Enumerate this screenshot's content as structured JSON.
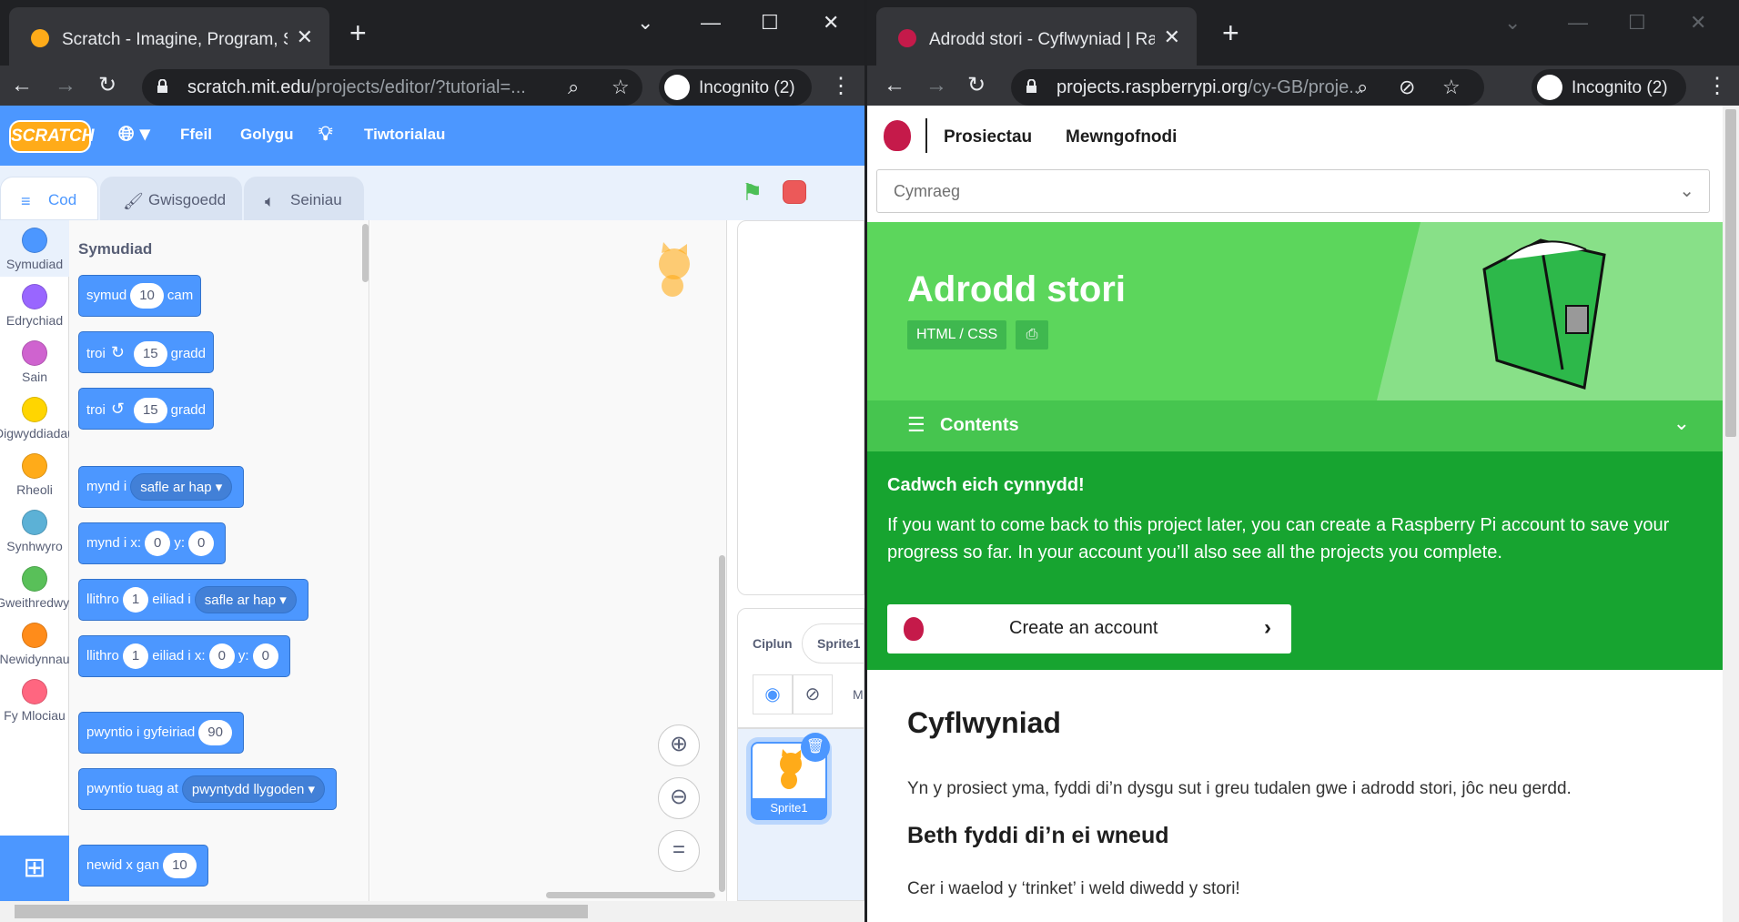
{
  "left_browser": {
    "tab_title": "Scratch - Imagine, Program, Share",
    "url_domain": "scratch.mit.edu",
    "url_path": "/projects/editor/?tutorial=...",
    "incognito": "Incognito (2)"
  },
  "right_browser": {
    "tab_title": "Adrodd stori - Cyflwyniad | Raspberry Pi Projects",
    "url_domain": "projects.raspberrypi.org",
    "url_path": "/cy-GB/proje...",
    "incognito": "Incognito (2)"
  },
  "scratch": {
    "logo": "SCRATCH",
    "menu": {
      "file": "Ffeil",
      "edit": "Golygu",
      "tutorials": "Tiwtorialau"
    },
    "tabs": {
      "code": "Cod",
      "costumes": "Gwisgoedd",
      "sounds": "Seiniau"
    },
    "categories": [
      {
        "label": "Symudiad",
        "color": "#4c97ff"
      },
      {
        "label": "Edrychiad",
        "color": "#9966ff"
      },
      {
        "label": "Sain",
        "color": "#cf63cf"
      },
      {
        "label": "Digwyddiadau",
        "color": "#ffd500"
      },
      {
        "label": "Rheoli",
        "color": "#ffab19"
      },
      {
        "label": "Synhwyro",
        "color": "#5cb1d6"
      },
      {
        "label": "Gweithredwyr",
        "color": "#59c059"
      },
      {
        "label": "Newidynnau",
        "color": "#ff8c1a"
      },
      {
        "label": "Fy Mlociau",
        "color": "#ff6680"
      }
    ],
    "palette_title": "Symudiad",
    "blocks": {
      "b1": {
        "a": "symud",
        "v": "10",
        "b": "cam"
      },
      "b2": {
        "a": "troi",
        "v": "15",
        "b": "gradd"
      },
      "b3": {
        "a": "troi",
        "v": "15",
        "b": "gradd"
      },
      "b4": {
        "a": "mynd i",
        "d": "safle ar hap"
      },
      "b5": {
        "a": "mynd i x:",
        "v1": "0",
        "b": "y:",
        "v2": "0"
      },
      "b6": {
        "a": "llithro",
        "v": "1",
        "b": "eiliad i",
        "d": "safle ar hap"
      },
      "b7": {
        "a": "llithro",
        "v1": "1",
        "b": "eiliad i x:",
        "v2": "0",
        "c": "y:",
        "v3": "0"
      },
      "b8": {
        "a": "pwyntio i gyfeiriad",
        "v": "90"
      },
      "b9": {
        "a": "pwyntio tuag at",
        "d": "pwyntydd llygoden"
      },
      "b10": {
        "a": "newid x gan",
        "v": "10"
      }
    },
    "sprite_label": "Ciplun",
    "sprite_name": "Sprite1",
    "sprite_thumb": "Sprite1",
    "m_cut": "M"
  },
  "rpi": {
    "nav_projects": "Prosiectau",
    "nav_login": "Mewngofnodi",
    "language": "Cymraeg",
    "hero_title": "Adrodd stori",
    "tag": "HTML / CSS",
    "contents": "Contents",
    "save_title": "Cadwch eich cynnydd!",
    "save_text": "If you want to come back to this project later, you can create a Raspberry Pi account to save your progress so far. In your account you’ll also see all the projects you complete.",
    "create_btn": "Create an account",
    "intro_h": "Cyflwyniad",
    "intro_p": "Yn y prosiect yma, fyddi di’n dysgu sut i greu tudalen gwe i adrodd stori, jôc neu gerdd.",
    "what_h": "Beth fyddi di’n ei wneud",
    "what_p": "Cer i waelod y ‘trinket’ i weld diwedd y stori!"
  }
}
